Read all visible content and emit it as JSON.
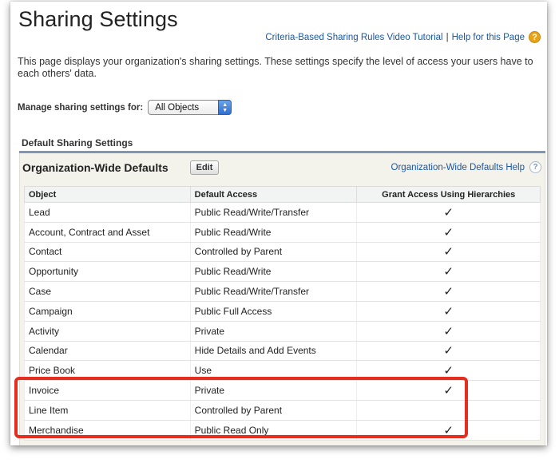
{
  "page": {
    "title": "Sharing Settings",
    "help_links": {
      "video_tutorial": "Criteria-Based Sharing Rules Video Tutorial",
      "separator": "|",
      "help_page": "Help for this Page"
    },
    "description": "This page displays your organization's sharing settings. These settings specify the level of access your users have to each others' data.",
    "manage": {
      "label": "Manage sharing settings for:",
      "selected": "All Objects"
    }
  },
  "section": {
    "header": "Default Sharing Settings",
    "panel": {
      "title": "Organization-Wide Defaults",
      "edit_label": "Edit",
      "help_link": "Organization-Wide Defaults Help"
    },
    "columns": [
      "Object",
      "Default Access",
      "Grant Access Using Hierarchies"
    ],
    "rows": [
      {
        "object": "Lead",
        "access": "Public Read/Write/Transfer",
        "grant": "✓"
      },
      {
        "object": "Account, Contract and Asset",
        "access": "Public Read/Write",
        "grant": "✓"
      },
      {
        "object": "Contact",
        "access": "Controlled by Parent",
        "grant": "✓"
      },
      {
        "object": "Opportunity",
        "access": "Public Read/Write",
        "grant": "✓"
      },
      {
        "object": "Case",
        "access": "Public Read/Write/Transfer",
        "grant": "✓"
      },
      {
        "object": "Campaign",
        "access": "Public Full Access",
        "grant": "✓"
      },
      {
        "object": "Activity",
        "access": "Private",
        "grant": "✓"
      },
      {
        "object": "Calendar",
        "access": "Hide Details and Add Events",
        "grant": "✓"
      },
      {
        "object": "Price Book",
        "access": "Use",
        "grant": "✓"
      },
      {
        "object": "Invoice",
        "access": "Private",
        "grant": "✓"
      },
      {
        "object": "Line Item",
        "access": "Controlled by Parent",
        "grant": ""
      },
      {
        "object": "Merchandise",
        "access": "Public Read Only",
        "grant": "✓"
      }
    ]
  },
  "colors": {
    "link": "#1a56a6",
    "highlight": "#e52d20",
    "section_rule": "#8094b3",
    "panel_bg": "#f3f3ec"
  },
  "icons": {
    "help": "help-question-icon",
    "select_arrows": "select-arrows-icon",
    "check": "checkmark-icon"
  }
}
